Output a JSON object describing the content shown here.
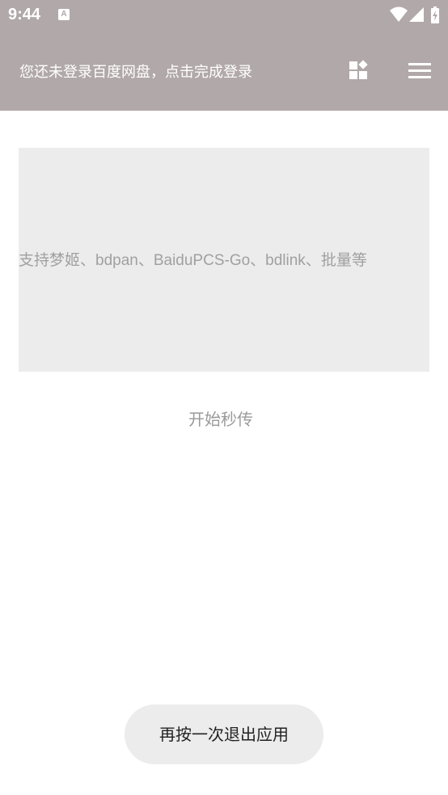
{
  "status_bar": {
    "time": "9:44",
    "notification_icon": "A",
    "icons": [
      "wifi-icon",
      "signal-icon",
      "battery-icon"
    ]
  },
  "app_bar": {
    "title": "您还未登录百度网盘，点击完成登录",
    "background_color": "#b1a8aa",
    "actions": [
      "apps-icon",
      "menu-icon"
    ]
  },
  "input": {
    "placeholder": "支持梦姬、bdpan、BaiduPCS-Go、bdlink、批量等"
  },
  "start_button": {
    "label": "开始秒传"
  },
  "toast": {
    "message": "再按一次退出应用"
  }
}
